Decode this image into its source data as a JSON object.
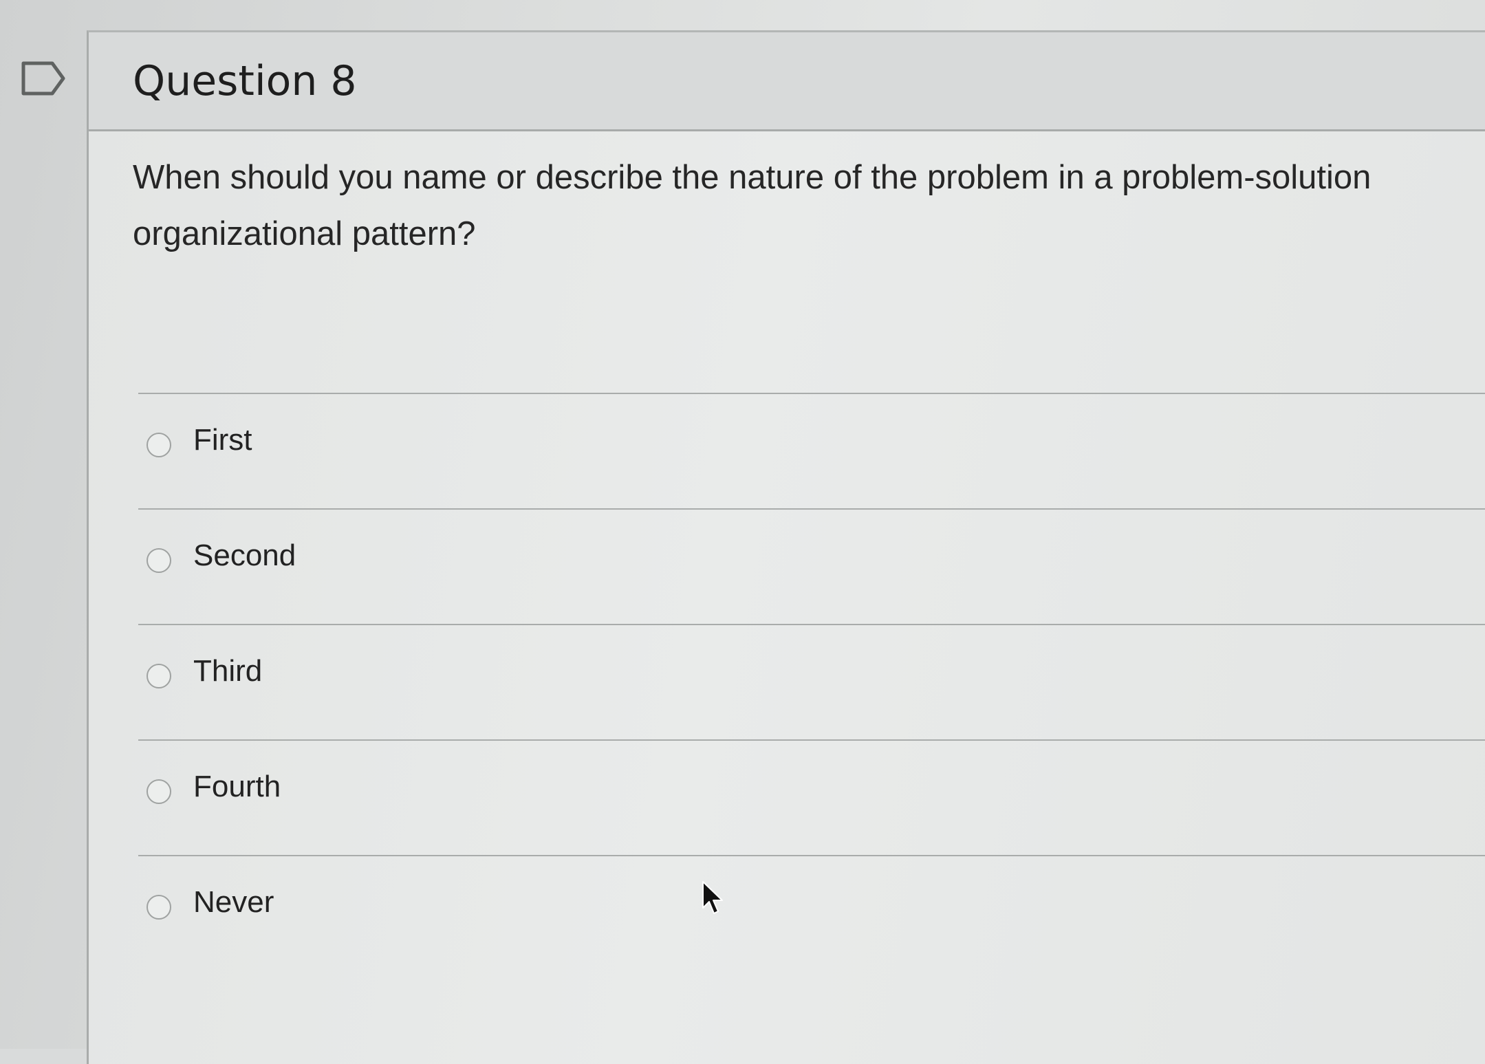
{
  "question": {
    "title": "Question 8",
    "text": "When should you name or describe the nature of the problem in a problem-solution organizational pattern?"
  },
  "answers": [
    {
      "label": "First",
      "selected": false
    },
    {
      "label": "Second",
      "selected": false
    },
    {
      "label": "Third",
      "selected": false
    },
    {
      "label": "Fourth",
      "selected": false
    },
    {
      "label": "Never",
      "selected": false
    }
  ],
  "icons": {
    "flag": "flag-icon",
    "radio": "radio-button-icon",
    "cursor": "mouse-cursor-icon"
  },
  "colors": {
    "background": "#dcdedd",
    "header": "#d8dada",
    "divider": "#a9acab",
    "text": "#262626"
  }
}
